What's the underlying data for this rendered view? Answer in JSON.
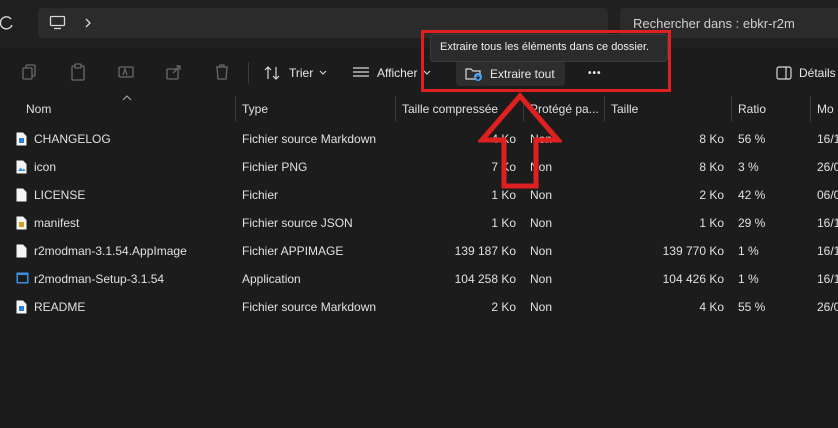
{
  "address": {
    "search_placeholder": "Rechercher dans : ebkr-r2m"
  },
  "toolbar": {
    "sort_label": "Trier",
    "view_label": "Afficher",
    "extract_label": "Extraire tout",
    "more_label": "•••",
    "details_label": "Détails"
  },
  "tooltip": {
    "text": "Extraire tous les éléments dans ce dossier."
  },
  "columns": {
    "name": "Nom",
    "type": "Type",
    "compressed": "Taille compressée",
    "protected": "Protégé pa...",
    "size": "Taille",
    "ratio": "Ratio",
    "modified": "Mo"
  },
  "files": [
    {
      "name": "CHANGELOG",
      "type": "Fichier source Markdown",
      "compressed": "4 Ko",
      "protected": "Non",
      "size": "8 Ko",
      "ratio": "56 %",
      "modified": "16/1",
      "icon": "markdown-file-icon"
    },
    {
      "name": "icon",
      "type": "Fichier PNG",
      "compressed": "7 Ko",
      "protected": "Non",
      "size": "8 Ko",
      "ratio": "3 %",
      "modified": "26/0",
      "icon": "image-file-icon"
    },
    {
      "name": "LICENSE",
      "type": "Fichier",
      "compressed": "1 Ko",
      "protected": "Non",
      "size": "2 Ko",
      "ratio": "42 %",
      "modified": "06/0",
      "icon": "generic-file-icon"
    },
    {
      "name": "manifest",
      "type": "Fichier source JSON",
      "compressed": "1 Ko",
      "protected": "Non",
      "size": "1 Ko",
      "ratio": "29 %",
      "modified": "16/1",
      "icon": "json-file-icon"
    },
    {
      "name": "r2modman-3.1.54.AppImage",
      "type": "Fichier APPIMAGE",
      "compressed": "139 187 Ko",
      "protected": "Non",
      "size": "139 770 Ko",
      "ratio": "1 %",
      "modified": "16/1",
      "icon": "generic-file-icon"
    },
    {
      "name": "r2modman-Setup-3.1.54",
      "type": "Application",
      "compressed": "104 258 Ko",
      "protected": "Non",
      "size": "104 426 Ko",
      "ratio": "1 %",
      "modified": "16/1",
      "icon": "application-icon"
    },
    {
      "name": "README",
      "type": "Fichier source Markdown",
      "compressed": "2 Ko",
      "protected": "Non",
      "size": "4 Ko",
      "ratio": "55 %",
      "modified": "26/0",
      "icon": "markdown-file-icon"
    }
  ],
  "colors": {
    "background": "#1c1c1c",
    "highlight_red": "#e02020",
    "accent_blue": "#4fa3f7"
  }
}
